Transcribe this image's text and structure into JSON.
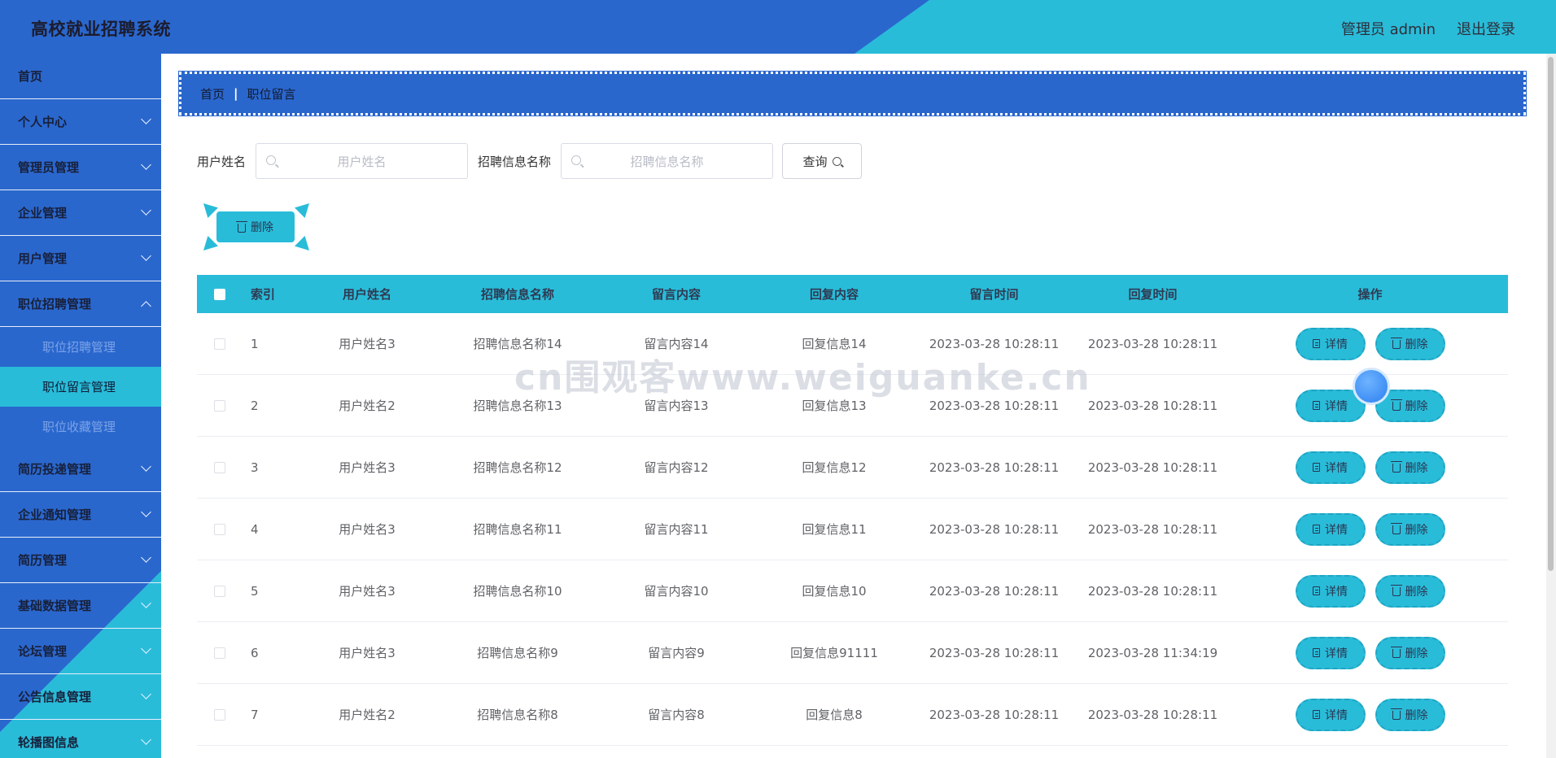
{
  "header": {
    "app_title": "高校就业招聘系统",
    "user_info": "管理员 admin",
    "logout": "退出登录"
  },
  "colors": {
    "primary_blue": "#2a67cd",
    "accent_cyan": "#29bcd9"
  },
  "sidebar": {
    "items": [
      {
        "label": "首页",
        "expandable": false
      },
      {
        "label": "个人中心",
        "expandable": true
      },
      {
        "label": "管理员管理",
        "expandable": true
      },
      {
        "label": "企业管理",
        "expandable": true
      },
      {
        "label": "用户管理",
        "expandable": true
      },
      {
        "label": "职位招聘管理",
        "expandable": true,
        "open": true,
        "children": [
          {
            "label": "职位招聘管理"
          },
          {
            "label": "职位留言管理",
            "active": true
          },
          {
            "label": "职位收藏管理"
          }
        ]
      },
      {
        "label": "简历投递管理",
        "expandable": true
      },
      {
        "label": "企业通知管理",
        "expandable": true
      },
      {
        "label": "简历管理",
        "expandable": true
      },
      {
        "label": "基础数据管理",
        "expandable": true
      },
      {
        "label": "论坛管理",
        "expandable": true
      },
      {
        "label": "公告信息管理",
        "expandable": true
      },
      {
        "label": "轮播图信息",
        "expandable": true
      }
    ]
  },
  "breadcrumb": {
    "home": "首页",
    "separator": "|",
    "current": "职位留言"
  },
  "search": {
    "user_label": "用户姓名",
    "user_placeholder": "用户姓名",
    "job_label": "招聘信息名称",
    "job_placeholder": "招聘信息名称",
    "query_button": "查询"
  },
  "toolbar": {
    "delete_label": "删除"
  },
  "table": {
    "columns": [
      "索引",
      "用户姓名",
      "招聘信息名称",
      "留言内容",
      "回复内容",
      "留言时间",
      "回复时间",
      "操作"
    ],
    "detail_label": "详情",
    "delete_label": "删除",
    "rows": [
      {
        "index": "1",
        "user": "用户姓名3",
        "job": "招聘信息名称14",
        "message": "留言内容14",
        "reply": "回复信息14",
        "message_time": "2023-03-28 10:28:11",
        "reply_time": "2023-03-28 10:28:11"
      },
      {
        "index": "2",
        "user": "用户姓名2",
        "job": "招聘信息名称13",
        "message": "留言内容13",
        "reply": "回复信息13",
        "message_time": "2023-03-28 10:28:11",
        "reply_time": "2023-03-28 10:28:11"
      },
      {
        "index": "3",
        "user": "用户姓名3",
        "job": "招聘信息名称12",
        "message": "留言内容12",
        "reply": "回复信息12",
        "message_time": "2023-03-28 10:28:11",
        "reply_time": "2023-03-28 10:28:11"
      },
      {
        "index": "4",
        "user": "用户姓名3",
        "job": "招聘信息名称11",
        "message": "留言内容11",
        "reply": "回复信息11",
        "message_time": "2023-03-28 10:28:11",
        "reply_time": "2023-03-28 10:28:11"
      },
      {
        "index": "5",
        "user": "用户姓名3",
        "job": "招聘信息名称10",
        "message": "留言内容10",
        "reply": "回复信息10",
        "message_time": "2023-03-28 10:28:11",
        "reply_time": "2023-03-28 10:28:11"
      },
      {
        "index": "6",
        "user": "用户姓名3",
        "job": "招聘信息名称9",
        "message": "留言内容9",
        "reply": "回复信息91111",
        "message_time": "2023-03-28 10:28:11",
        "reply_time": "2023-03-28 11:34:19"
      },
      {
        "index": "7",
        "user": "用户姓名2",
        "job": "招聘信息名称8",
        "message": "留言内容8",
        "reply": "回复信息8",
        "message_time": "2023-03-28 10:28:11",
        "reply_time": "2023-03-28 10:28:11"
      }
    ]
  },
  "watermark": "cn围观客www.weiguanke.cn"
}
